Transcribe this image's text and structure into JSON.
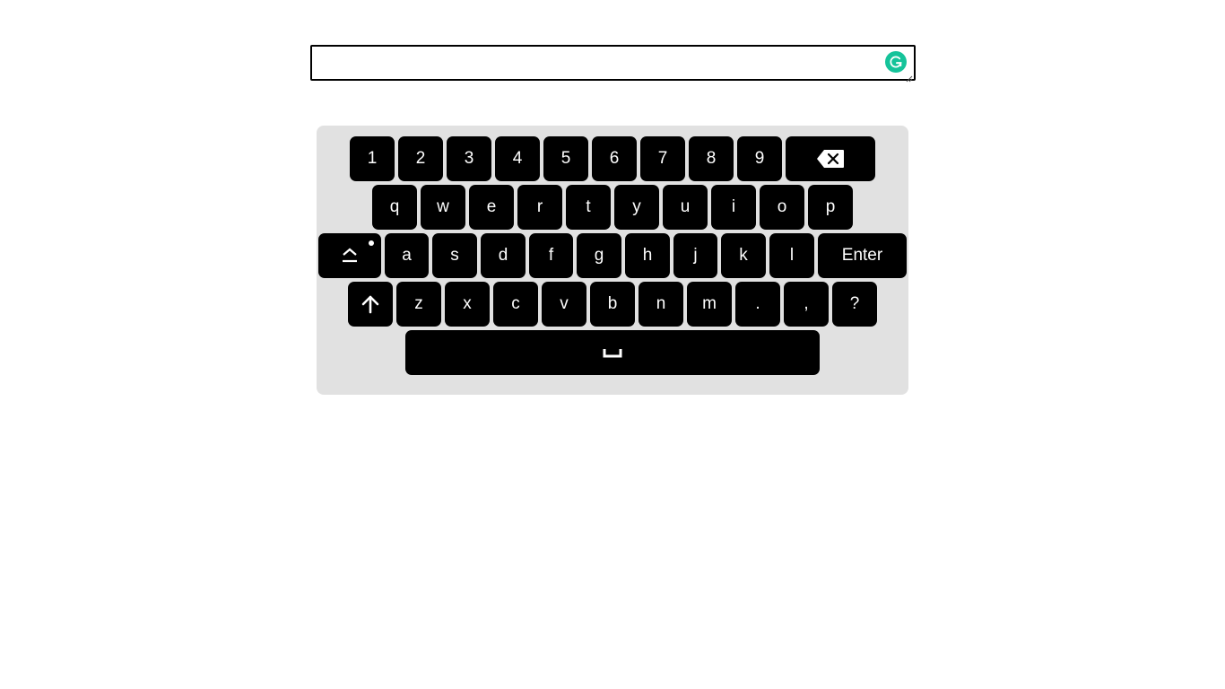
{
  "text_area": {
    "value": "",
    "placeholder": ""
  },
  "colors": {
    "keyboard_bg": "#e1e1e1",
    "key_bg": "#000000",
    "key_fg": "#ffffff",
    "grammarly": "#15c39a"
  },
  "keyboard": {
    "row1": [
      "1",
      "2",
      "3",
      "4",
      "5",
      "6",
      "7",
      "8",
      "9"
    ],
    "backspace_icon": "backspace-icon",
    "row2": [
      "q",
      "w",
      "e",
      "r",
      "t",
      "y",
      "u",
      "i",
      "o",
      "p"
    ],
    "row3": [
      "a",
      "s",
      "d",
      "f",
      "g",
      "h",
      "j",
      "k",
      "l"
    ],
    "layout_toggle_icon": "layout-toggle-icon",
    "enter_label": "Enter",
    "shift_icon": "shift-arrow-up-icon",
    "row4": [
      "z",
      "x",
      "c",
      "v",
      "b",
      "n",
      "m",
      ".",
      ",",
      "?"
    ],
    "space_icon": "space-icon"
  }
}
